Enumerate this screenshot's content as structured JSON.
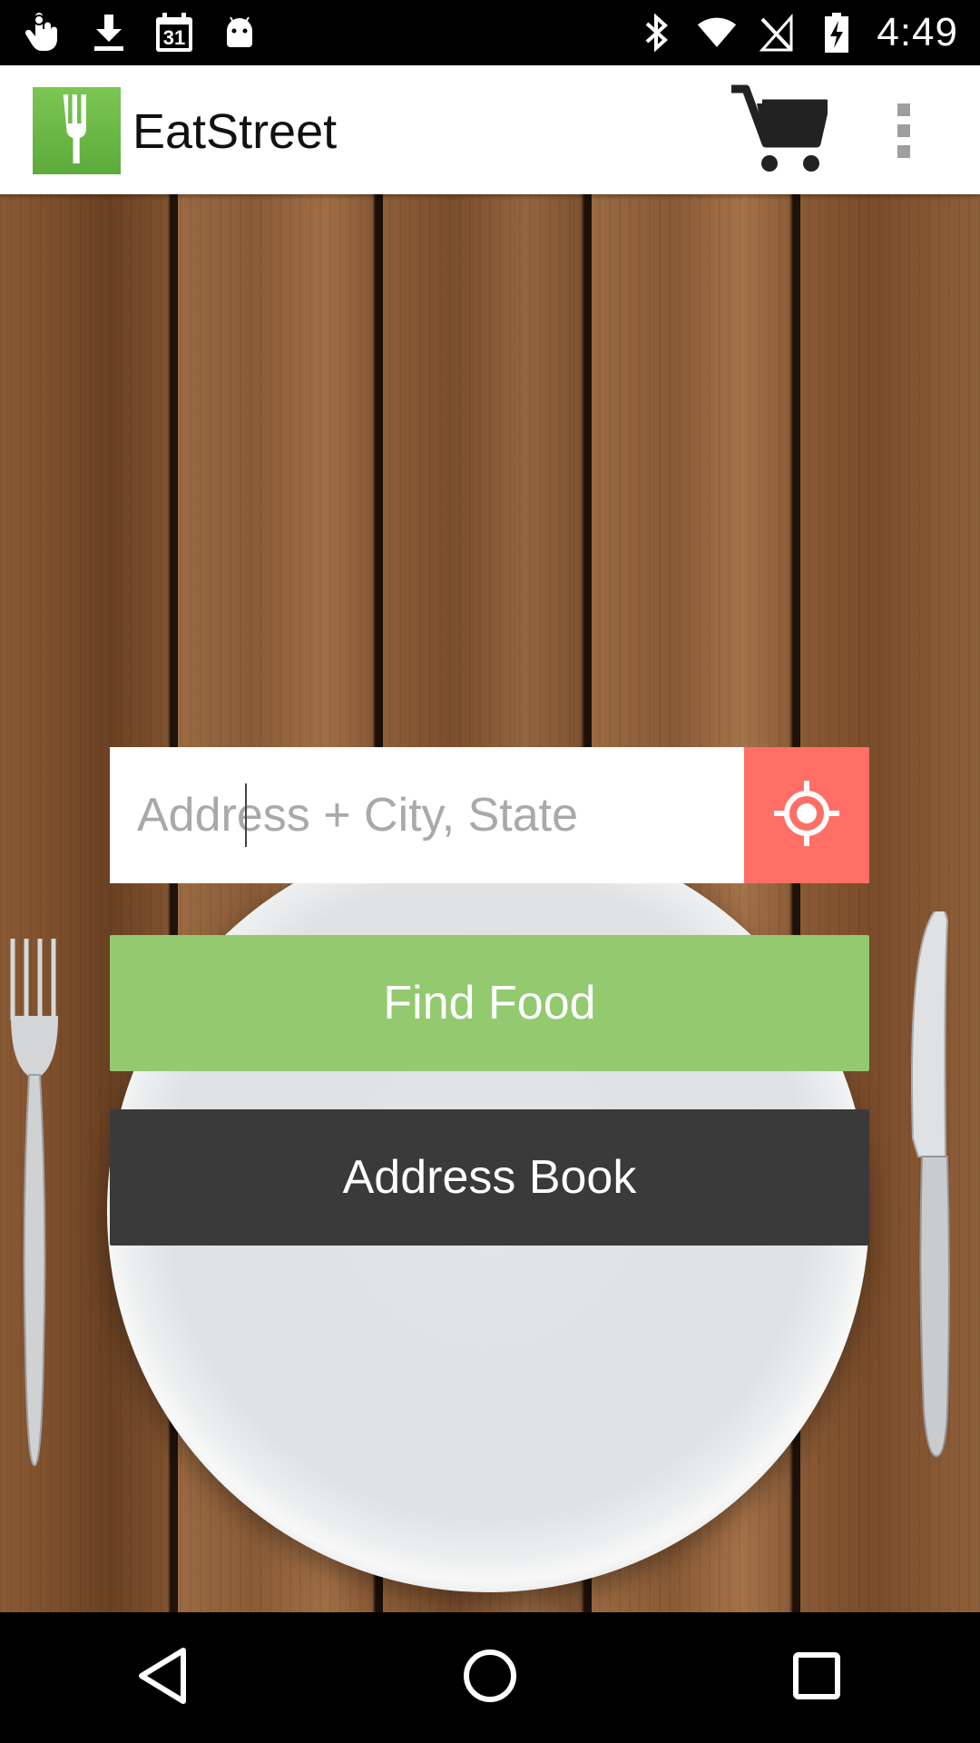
{
  "status_bar": {
    "time": "4:49",
    "left_icons": [
      "hand-icon",
      "download-icon",
      "calendar-icon",
      "android-icon"
    ],
    "calendar_day": "31",
    "right_icons": [
      "bluetooth-icon",
      "wifi-icon",
      "no-sim-icon",
      "battery-charging-icon"
    ]
  },
  "app_bar": {
    "title": "EatStreet",
    "logo_icon": "fork-icon",
    "cart_icon": "cart-icon",
    "overflow_icon": "more-vert-icon"
  },
  "search": {
    "placeholder": "Address + City, State",
    "value": "",
    "locate_icon": "my-location-icon"
  },
  "buttons": {
    "find_food": "Find Food",
    "address_book": "Address Book"
  },
  "colors": {
    "brand_green": "#93c96f",
    "locate_red": "#ff6f66",
    "dark_button": "#3a3a3a"
  },
  "nav_bar": {
    "icons": [
      "back-icon",
      "home-icon",
      "recents-icon"
    ]
  }
}
